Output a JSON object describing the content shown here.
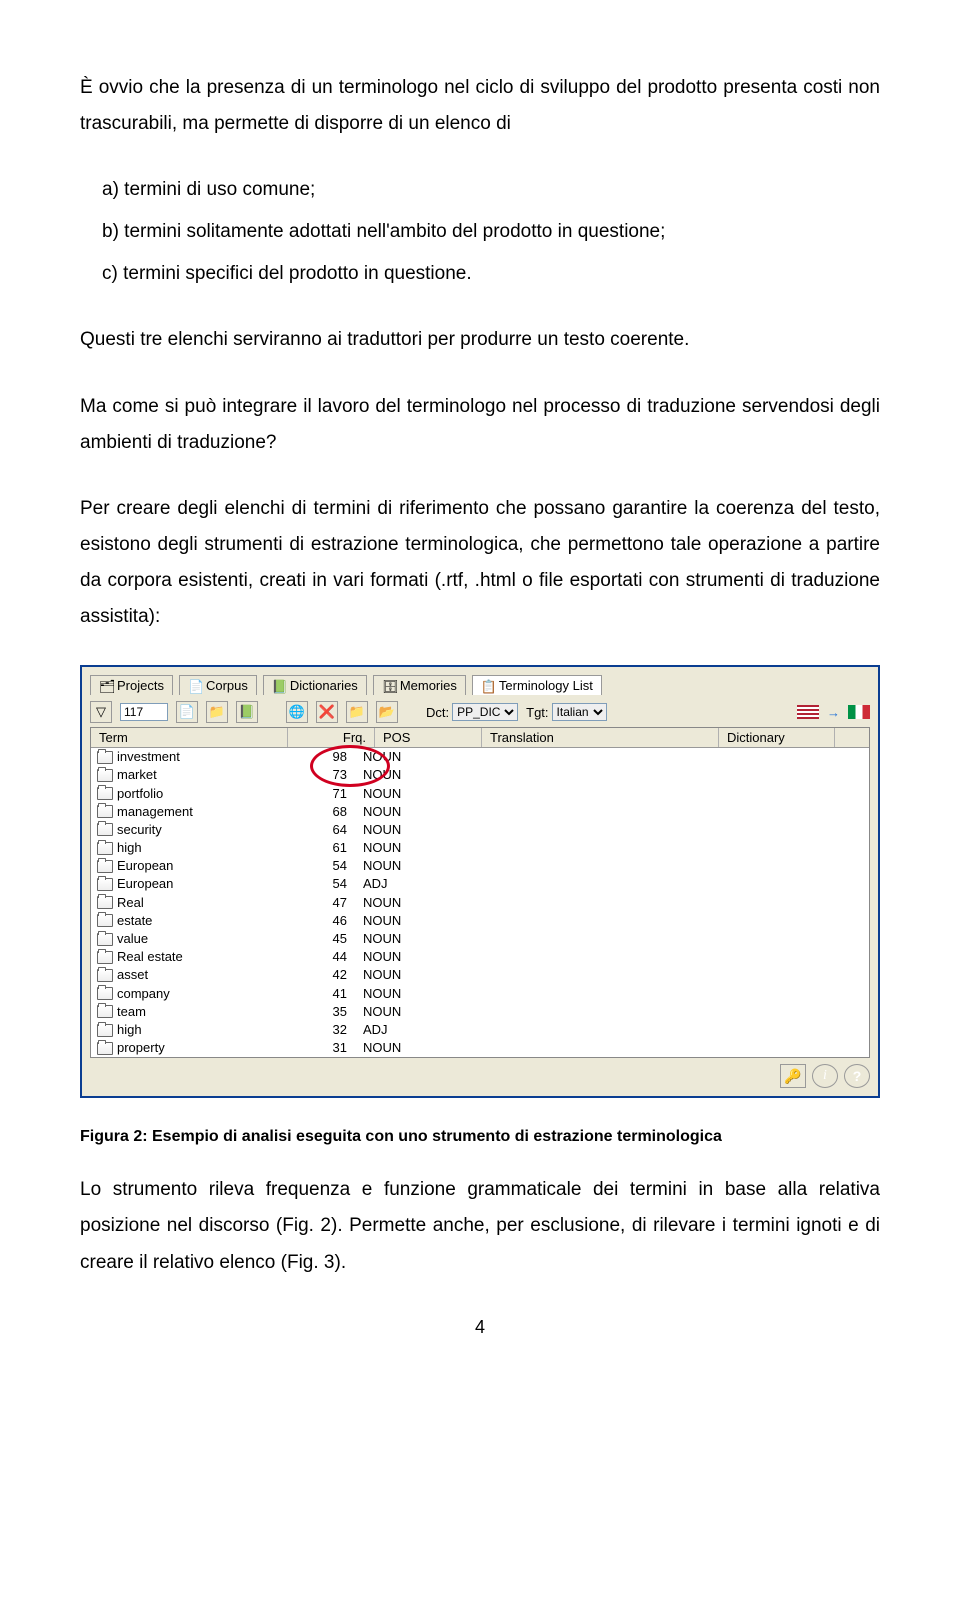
{
  "p1": "È ovvio che la presenza di un terminologo nel ciclo di sviluppo del prodotto presenta costi non trascurabili, ma permette di disporre di un elenco di",
  "li_a": "a) termini di uso comune;",
  "li_b": "b) termini solitamente adottati nell'ambito del prodotto in questione;",
  "li_c": "c) termini specifici del prodotto in questione.",
  "p2": "Questi tre elenchi serviranno ai traduttori per produrre un testo coerente.",
  "p3": "Ma come si può integrare il lavoro del terminologo nel processo di traduzione servendosi degli ambienti di traduzione?",
  "p4": "Per creare degli elenchi di termini di riferimento che possano garantire la coerenza del testo, esistono degli strumenti di estrazione terminologica, che permettono tale operazione a partire da corpora esistenti, creati in vari formati (.rtf, .html o file esportati con strumenti di traduzione assistita):",
  "tabs": {
    "projects": "Projects",
    "corpus": "Corpus",
    "dict": "Dictionaries",
    "mem": "Memories",
    "termlist": "Terminology List"
  },
  "toolbar": {
    "count": "117",
    "dct_label": "Dct:",
    "dct_value": "PP_DIC",
    "tgt_label": "Tgt:",
    "tgt_value": "Italian"
  },
  "headers": {
    "term": "Term",
    "frq": "Frq.",
    "pos": "POS",
    "trans": "Translation",
    "dict": "Dictionary"
  },
  "rows": [
    {
      "term": "investment",
      "frq": "98",
      "pos": "NOUN"
    },
    {
      "term": "market",
      "frq": "73",
      "pos": "NOUN"
    },
    {
      "term": "portfolio",
      "frq": "71",
      "pos": "NOUN"
    },
    {
      "term": "management",
      "frq": "68",
      "pos": "NOUN"
    },
    {
      "term": "security",
      "frq": "64",
      "pos": "NOUN"
    },
    {
      "term": "high",
      "frq": "61",
      "pos": "NOUN"
    },
    {
      "term": "European",
      "frq": "54",
      "pos": "NOUN"
    },
    {
      "term": "European",
      "frq": "54",
      "pos": "ADJ"
    },
    {
      "term": "Real",
      "frq": "47",
      "pos": "NOUN"
    },
    {
      "term": "estate",
      "frq": "46",
      "pos": "NOUN"
    },
    {
      "term": "value",
      "frq": "45",
      "pos": "NOUN"
    },
    {
      "term": "Real estate",
      "frq": "44",
      "pos": "NOUN"
    },
    {
      "term": "asset",
      "frq": "42",
      "pos": "NOUN"
    },
    {
      "term": "company",
      "frq": "41",
      "pos": "NOUN"
    },
    {
      "term": "team",
      "frq": "35",
      "pos": "NOUN"
    },
    {
      "term": "high",
      "frq": "32",
      "pos": "ADJ"
    },
    {
      "term": "property",
      "frq": "31",
      "pos": "NOUN"
    }
  ],
  "caption": "Figura 2: Esempio di analisi eseguita con uno strumento di estrazione terminologica",
  "p5": "Lo strumento rileva frequenza e funzione grammaticale dei termini in base alla relativa posizione nel discorso (Fig. 2). Permette anche, per esclusione, di rilevare i termini ignoti e di creare il relativo elenco (Fig. 3).",
  "page": "4"
}
